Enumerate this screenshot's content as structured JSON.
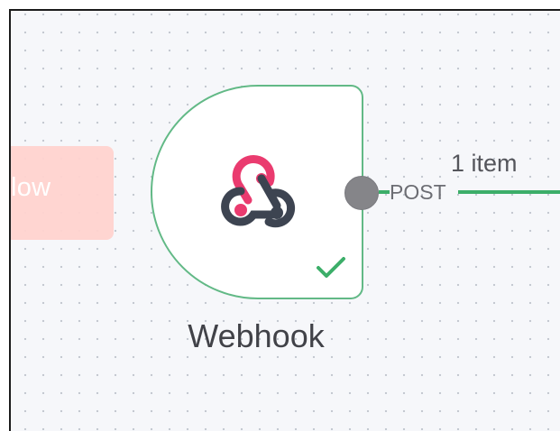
{
  "canvas": {
    "previous_node": {
      "label": "low",
      "color": "#ffd3cf"
    },
    "webhook_node": {
      "title": "Webhook",
      "icon": "webhook-icon",
      "status_icon": "check-icon",
      "border_color": "#62b986",
      "status": "success"
    },
    "output": {
      "handle_icon": "output-handle-dot",
      "label": "POST"
    },
    "edge": {
      "label": "1 item",
      "color": "#3cae69"
    }
  }
}
